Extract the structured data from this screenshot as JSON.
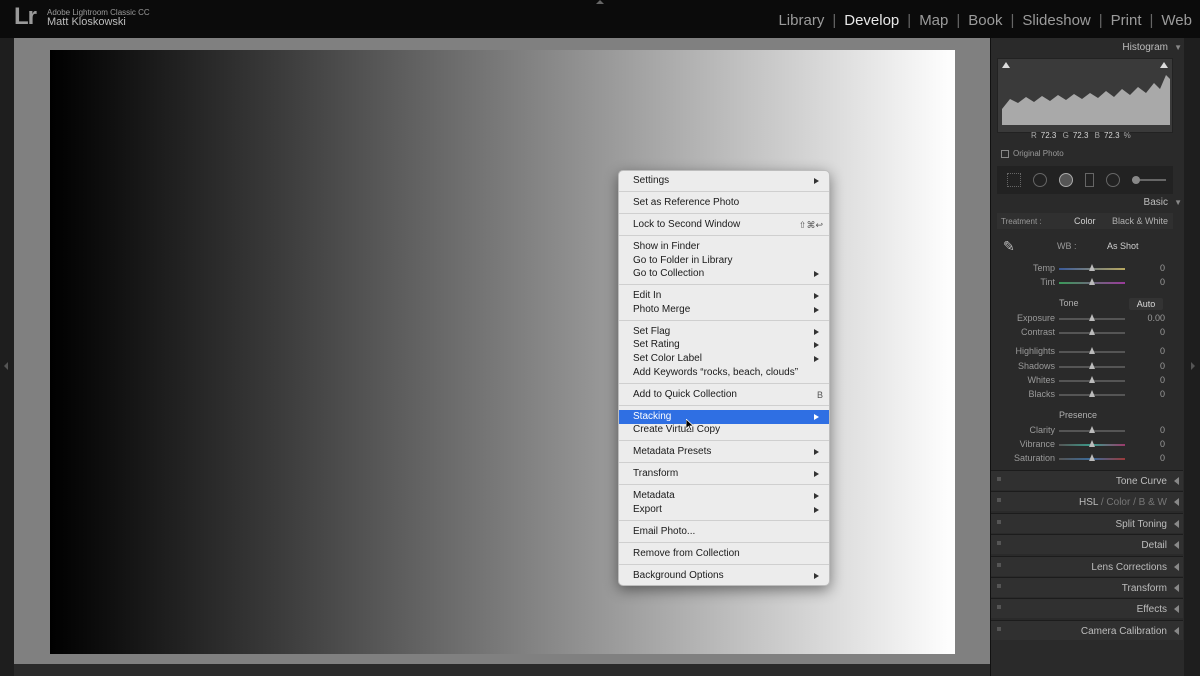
{
  "app": {
    "logo": "Lr",
    "title": "Adobe Lightroom Classic CC",
    "user": "Matt Kloskowski"
  },
  "modules": [
    "Library",
    "Develop",
    "Map",
    "Book",
    "Slideshow",
    "Print",
    "Web"
  ],
  "active_module": "Develop",
  "histogram": {
    "header": "Histogram",
    "r_label": "R",
    "r_value": "72.3",
    "g_label": "G",
    "g_value": "72.3",
    "b_label": "B",
    "b_value": "72.3",
    "unit": "%",
    "original_photo": "Original Photo"
  },
  "basic": {
    "header": "Basic",
    "treatment_label": "Treatment :",
    "treatment_color": "Color",
    "treatment_bw": "Black & White",
    "wb_label": "WB :",
    "wb_value": "As Shot",
    "temp_label": "Temp",
    "temp_value": "0",
    "tint_label": "Tint",
    "tint_value": "0",
    "tone_label": "Tone",
    "auto_label": "Auto",
    "exposure_label": "Exposure",
    "exposure_value": "0.00",
    "contrast_label": "Contrast",
    "contrast_value": "0",
    "highlights_label": "Highlights",
    "highlights_value": "0",
    "shadows_label": "Shadows",
    "shadows_value": "0",
    "whites_label": "Whites",
    "whites_value": "0",
    "blacks_label": "Blacks",
    "blacks_value": "0",
    "presence_label": "Presence",
    "clarity_label": "Clarity",
    "clarity_value": "0",
    "vibrance_label": "Vibrance",
    "vibrance_value": "0",
    "saturation_label": "Saturation",
    "saturation_value": "0"
  },
  "panels": {
    "tone_curve": "Tone Curve",
    "hsl": "HSL",
    "hsl_sep1": "/",
    "hsl_color": "Color",
    "hsl_sep2": "/",
    "hsl_bw": "B & W",
    "split_toning": "Split Toning",
    "detail": "Detail",
    "lens_corrections": "Lens Corrections",
    "transform": "Transform",
    "effects": "Effects",
    "camera_calibration": "Camera Calibration"
  },
  "menu": {
    "settings": "Settings",
    "set_reference": "Set as Reference Photo",
    "lock_second": "Lock to Second Window",
    "lock_shortcut": "⇧⌘↩",
    "show_finder": "Show in Finder",
    "go_folder": "Go to Folder in Library",
    "go_collection": "Go to Collection",
    "edit_in": "Edit In",
    "photo_merge": "Photo Merge",
    "set_flag": "Set Flag",
    "set_rating": "Set Rating",
    "set_color_label": "Set Color Label",
    "add_keywords": "Add Keywords “rocks, beach, clouds”",
    "add_quick": "Add to Quick Collection",
    "add_quick_shortcut": "B",
    "stacking": "Stacking",
    "create_virtual": "Create Virtual Copy",
    "metadata_presets": "Metadata Presets",
    "transform": "Transform",
    "metadata": "Metadata",
    "export": "Export",
    "email_photo": "Email Photo...",
    "remove_collection": "Remove from Collection",
    "background_options": "Background Options"
  },
  "colors": {
    "highlight": "#2f6fe3",
    "panel_bg": "#2a2a2a",
    "menu_bg": "#ececec"
  }
}
